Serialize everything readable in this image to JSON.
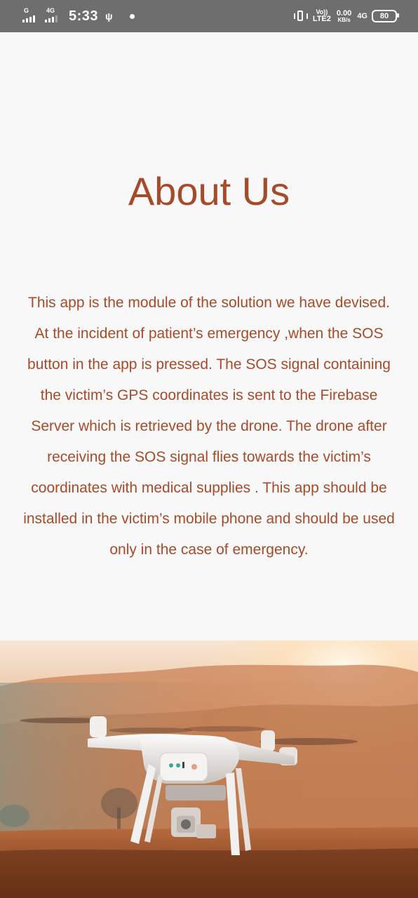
{
  "status_bar": {
    "sim1_label": "G",
    "sim2_label": "4G",
    "time": "5:33",
    "volte_label": "Vo))",
    "lte_label": "LTE2",
    "speed_value": "0.00",
    "speed_unit": "KB/s",
    "network_label": "4G",
    "battery_level": "80",
    "icons": [
      "signal-icon",
      "usb-icon",
      "notification-dot-icon",
      "vibrate-icon",
      "battery-icon"
    ]
  },
  "page": {
    "title": "About Us",
    "description": "This app is the module of the solution we have devised.   At the incident of patient’s emergency ,when the SOS button in the app is pressed. The SOS signal containing the victim’s GPS coordinates is sent to the Firebase Server which is retrieved by the drone. The drone after receiving the SOS signal flies towards the victim’s coordinates with medical supplies . This app should be installed in the victim’s mobile phone and should be used only in the case of emergency."
  },
  "colors": {
    "accent": "#a64b2a",
    "background": "#f8f8f8",
    "status_bar": "#6e6e6e"
  }
}
